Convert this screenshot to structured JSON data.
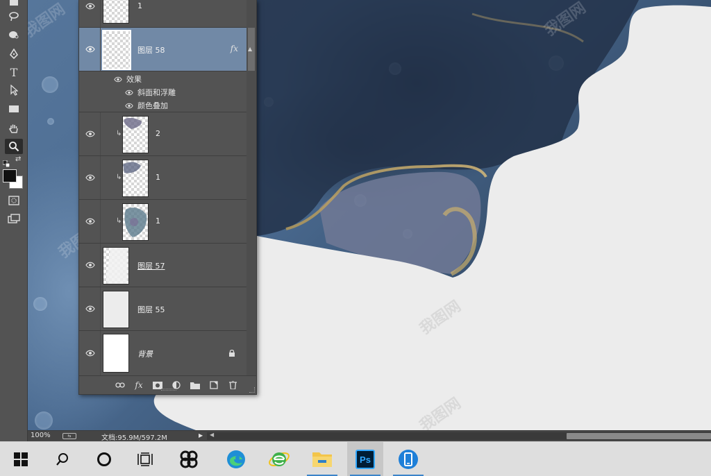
{
  "app": "Photoshop",
  "layers_panel": {
    "layers": [
      {
        "name": "1",
        "visible": true,
        "clipped": false,
        "selected": false,
        "thumb": "transparent-partial"
      },
      {
        "name": "图层 58",
        "visible": true,
        "clipped": false,
        "selected": true,
        "fx": "fx",
        "thumb": "transparent"
      },
      {
        "name": "2",
        "visible": true,
        "clipped": true,
        "selected": false,
        "thumb": "ink"
      },
      {
        "name": "1",
        "visible": true,
        "clipped": true,
        "selected": false,
        "thumb": "ink"
      },
      {
        "name": "1",
        "visible": true,
        "clipped": true,
        "selected": false,
        "thumb": "ink"
      },
      {
        "name": "图层 57",
        "visible": true,
        "clipped": false,
        "selected": false,
        "thumb": "transparent-white"
      },
      {
        "name": "图层 55",
        "visible": true,
        "clipped": false,
        "selected": false,
        "thumb": "solid-grey"
      },
      {
        "name": "背景",
        "visible": true,
        "clipped": false,
        "selected": false,
        "locked": true,
        "thumb": "solid-white"
      }
    ],
    "effects": {
      "label": "效果",
      "items": [
        "斜面和浮雕",
        "颜色叠加"
      ]
    },
    "footer_icons": [
      "link-icon",
      "fx-icon",
      "mask-icon",
      "adjustment-icon",
      "folder-icon",
      "new-layer-icon",
      "trash-icon"
    ],
    "footer_fx_label": "fx"
  },
  "status": {
    "zoom": "100%",
    "doc_info": "文档:95.9M/597.2M"
  },
  "taskbar": {
    "apps": [
      "windows-start",
      "search",
      "cortana",
      "task-view",
      "app-pinwheel",
      "edge",
      "ie-green",
      "file-explorer",
      "photoshop",
      "tablet-app"
    ],
    "ps_label": "Ps"
  },
  "watermark": "我图网",
  "colors": {
    "panel": "#535353",
    "selected_layer": "#7189a6",
    "canvas_light": "#ececec",
    "taskbar": "#dedede",
    "running_indicator": "#3a83c9"
  }
}
